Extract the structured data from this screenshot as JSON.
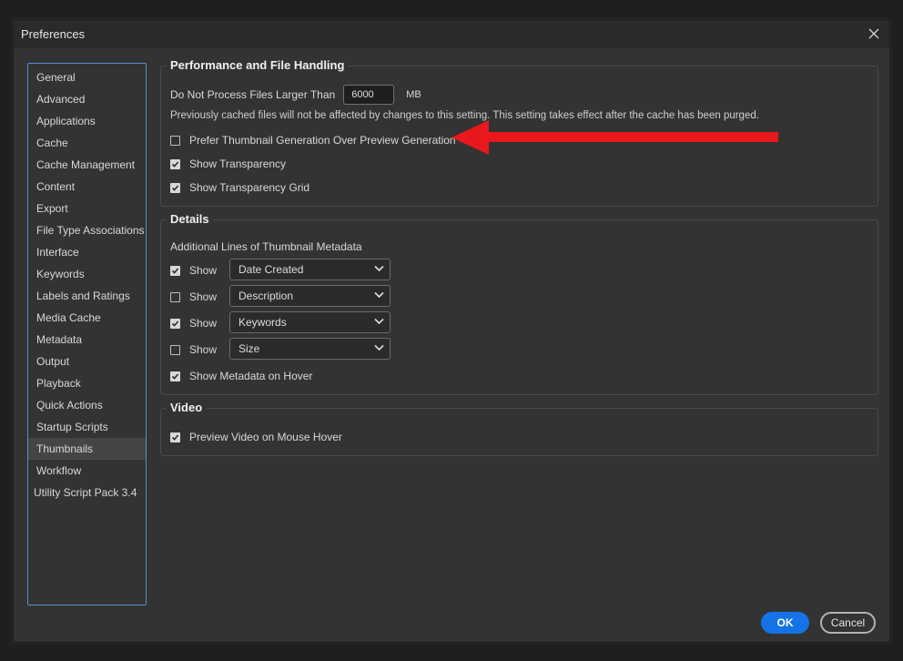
{
  "window": {
    "title": "Preferences"
  },
  "sidebar": {
    "items": [
      {
        "label": "General"
      },
      {
        "label": "Advanced"
      },
      {
        "label": "Applications"
      },
      {
        "label": "Cache"
      },
      {
        "label": "Cache Management"
      },
      {
        "label": "Content"
      },
      {
        "label": "Export"
      },
      {
        "label": "File Type Associations"
      },
      {
        "label": "Interface"
      },
      {
        "label": "Keywords"
      },
      {
        "label": "Labels and Ratings"
      },
      {
        "label": "Media Cache"
      },
      {
        "label": "Metadata"
      },
      {
        "label": "Output"
      },
      {
        "label": "Playback"
      },
      {
        "label": "Quick Actions"
      },
      {
        "label": "Startup Scripts"
      },
      {
        "label": "Thumbnails"
      },
      {
        "label": "Workflow"
      },
      {
        "label": "Utility Script Pack 3.4"
      }
    ],
    "selected": "Thumbnails"
  },
  "performance": {
    "title": "Performance and File Handling",
    "max_size_label": "Do Not Process Files Larger Than",
    "max_size_value": "6000",
    "max_size_unit": "MB",
    "note": "Previously cached files will not be affected by changes to this setting. This setting takes effect after the cache has been purged.",
    "prefer_thumbnail_label": "Prefer Thumbnail Generation Over Preview Generation",
    "prefer_thumbnail_checked": false,
    "show_transparency_label": "Show Transparency",
    "show_transparency_checked": true,
    "show_transparency_grid_label": "Show Transparency Grid",
    "show_transparency_grid_checked": true
  },
  "details": {
    "title": "Details",
    "subtitle": "Additional Lines of Thumbnail Metadata",
    "lines": [
      {
        "show_label": "Show",
        "checked": true,
        "value": "Date Created"
      },
      {
        "show_label": "Show",
        "checked": false,
        "value": "Description"
      },
      {
        "show_label": "Show",
        "checked": true,
        "value": "Keywords"
      },
      {
        "show_label": "Show",
        "checked": false,
        "value": "Size"
      }
    ],
    "hover_label": "Show Metadata on Hover",
    "hover_checked": true
  },
  "video": {
    "title": "Video",
    "preview_label": "Preview Video on Mouse Hover",
    "preview_checked": true
  },
  "buttons": {
    "ok": "OK",
    "cancel": "Cancel"
  },
  "colors": {
    "accent": "#1473e6",
    "annotation_arrow": "#e8181c",
    "sidebar_border": "#5b8bd6"
  }
}
